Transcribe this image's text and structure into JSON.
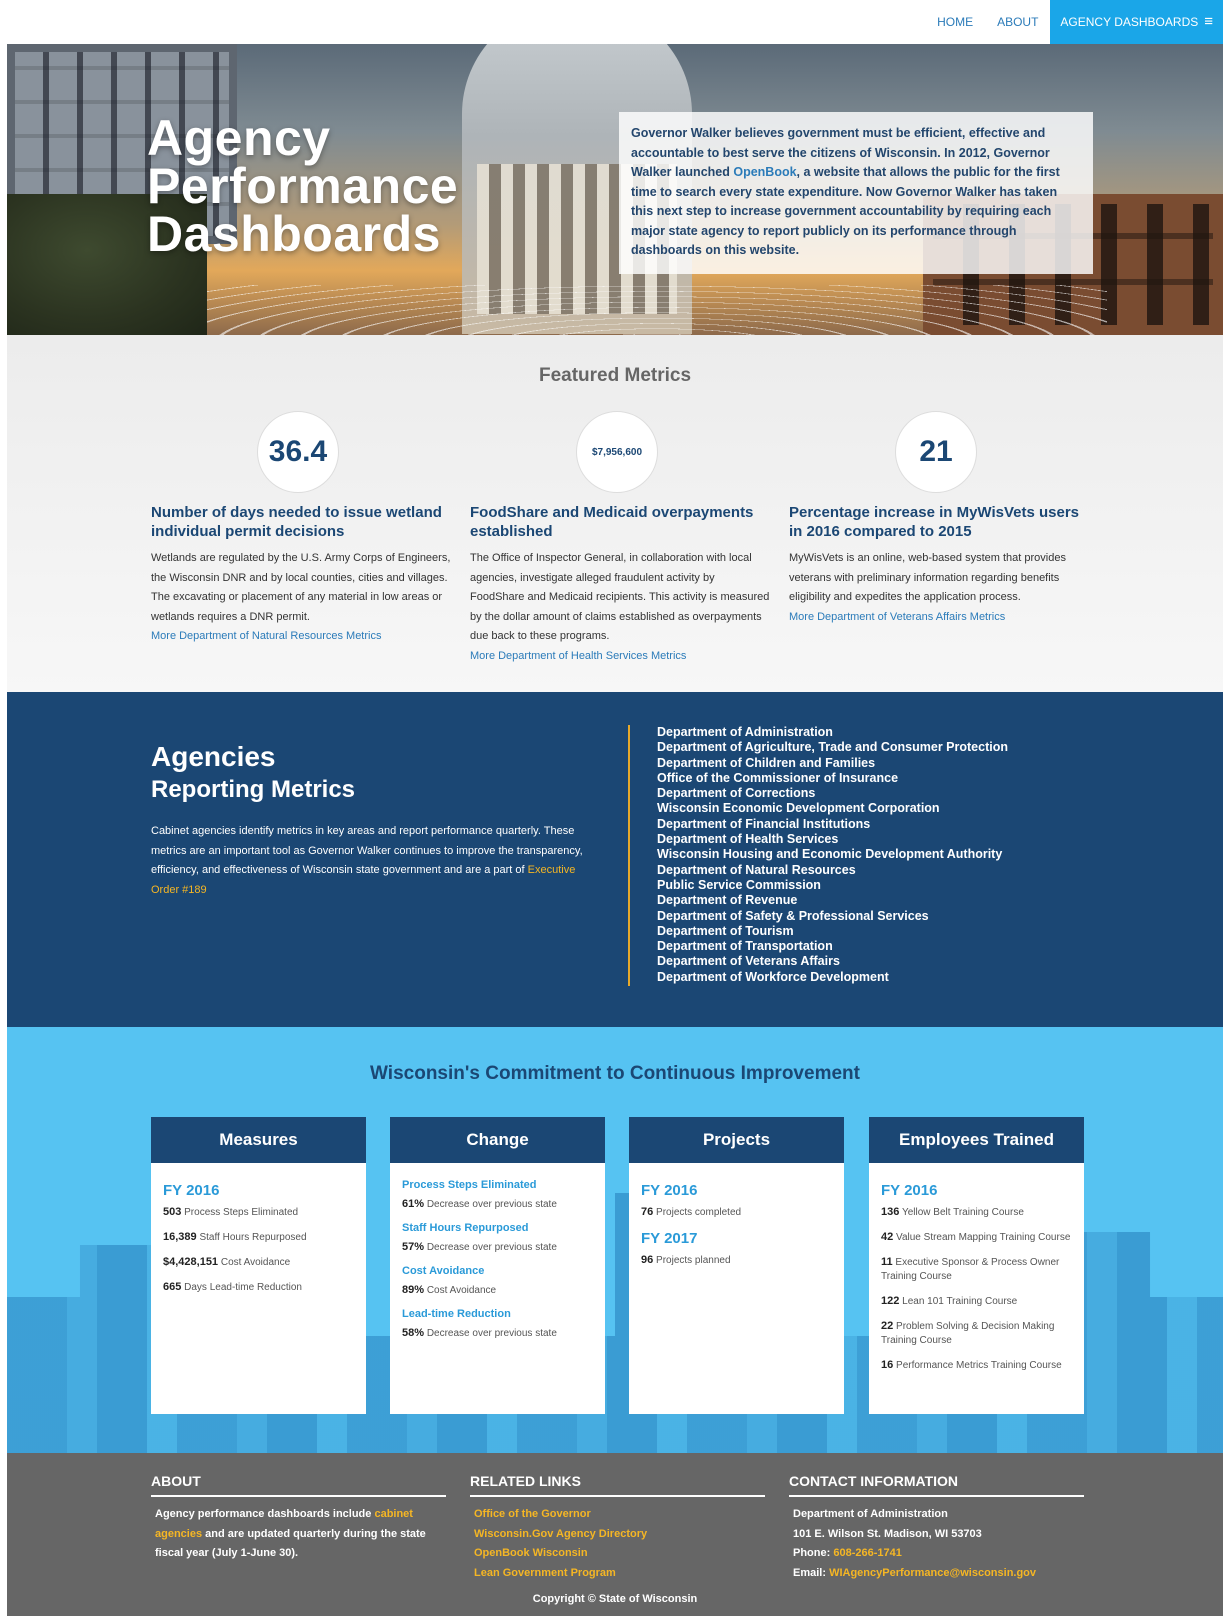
{
  "nav": {
    "home": "HOME",
    "about": "ABOUT",
    "dashboards": "AGENCY DASHBOARDS",
    "menu_glyph": "≡"
  },
  "hero": {
    "title_line1": "Agency",
    "title_line2": "Performance",
    "title_line3": "Dashboards",
    "intro_before": "Governor Walker believes government must be efficient, effective and accountable to best serve the citizens of Wisconsin. In 2012, Governor Walker launched ",
    "intro_link": "OpenBook",
    "intro_after": ", a website that allows the public for the first time to search every state expenditure. Now Governor Walker has taken this next step to increase government accountability by requiring each major state agency to report publicly on its performance through dashboards on this website."
  },
  "featured": {
    "title": "Featured Metrics",
    "metrics": [
      {
        "value": "36.4",
        "heading": "Number of days needed to issue wetland individual permit decisions",
        "text": "Wetlands are regulated by the U.S. Army Corps of Engineers, the Wisconsin DNR and by local counties, cities and villages. The excavating or placement of any material in low areas or wetlands requires a DNR permit.",
        "link": "More Department of Natural Resources Metrics"
      },
      {
        "value": "$7,956,600",
        "heading": "FoodShare and Medicaid overpayments established",
        "text": "The Office of Inspector General, in collaboration with local agencies, investigate alleged fraudulent activity by FoodShare and Medicaid recipients. This activity is measured by the dollar amount of claims established as overpayments due back to these programs.",
        "link": "More Department of Health Services Metrics"
      },
      {
        "value": "21",
        "heading": "Percentage increase in MyWisVets users in 2016 compared to 2015",
        "text": "MyWisVets is an online, web-based system that provides veterans with preliminary information regarding benefits eligibility and expedites the application process.",
        "link": "More Department of Veterans Affairs Metrics"
      }
    ]
  },
  "agencies": {
    "title1": "Agencies",
    "title2": "Reporting Metrics",
    "desc_before": "Cabinet agencies identify metrics in key areas and report performance quarterly. These metrics are an important tool as Governor Walker continues to improve the transparency, efficiency, and effectiveness of Wisconsin state government and are a part of ",
    "desc_link": "Executive Order #189",
    "list": [
      "Department of Administration",
      "Department of Agriculture, Trade and Consumer Protection",
      "Department of Children and Families",
      "Office of the Commissioner of Insurance",
      "Department of Corrections",
      "Wisconsin Economic Development Corporation",
      "Department of Financial Institutions",
      "Department of Health Services",
      "Wisconsin Housing and Economic Development Authority",
      "Department of Natural Resources",
      "Public Service Commission",
      "Department of Revenue",
      "Department of Safety & Professional Services",
      "Department of Tourism",
      "Department of Transportation",
      "Department of Veterans Affairs",
      "Department of Workforce Development"
    ]
  },
  "improve": {
    "title": "Wisconsin's Commitment to Continuous Improvement",
    "measures": {
      "head": "Measures",
      "fy": "FY 2016",
      "rows": [
        {
          "num": "503",
          "label": "Process Steps Eliminated"
        },
        {
          "num": "16,389",
          "label": "Staff Hours Repurposed"
        },
        {
          "num": "$4,428,151",
          "label": "Cost Avoidance"
        },
        {
          "num": "665",
          "label": "Days Lead-time Reduction"
        }
      ]
    },
    "change": {
      "head": "Change",
      "groups": [
        {
          "sub": "Process Steps Eliminated",
          "num": "61%",
          "label": "Decrease over previous state"
        },
        {
          "sub": "Staff Hours Repurposed",
          "num": "57%",
          "label": "Decrease over previous state"
        },
        {
          "sub": "Cost Avoidance",
          "num": "89%",
          "label": "Cost Avoidance"
        },
        {
          "sub": "Lead-time Reduction",
          "num": "58%",
          "label": "Decrease over previous state"
        }
      ]
    },
    "projects": {
      "head": "Projects",
      "fy1": "FY 2016",
      "row1": {
        "num": "76",
        "label": "Projects completed"
      },
      "fy2": "FY 2017",
      "row2": {
        "num": "96",
        "label": "Projects planned"
      }
    },
    "trained": {
      "head": "Employees Trained",
      "fy": "FY 2016",
      "rows": [
        {
          "num": "136",
          "label": "Yellow Belt Training Course"
        },
        {
          "num": "42",
          "label": "Value Stream Mapping Training Course"
        },
        {
          "num": "11",
          "label": "Executive Sponsor & Process Owner Training Course"
        },
        {
          "num": "122",
          "label": "Lean 101 Training Course"
        },
        {
          "num": "22",
          "label": "Problem Solving & Decision Making Training Course"
        },
        {
          "num": "16",
          "label": "Performance Metrics Training Course"
        }
      ]
    }
  },
  "footer": {
    "about": {
      "head": "ABOUT",
      "before": "Agency performance dashboards include ",
      "link": "cabinet agencies",
      "after": " and are updated quarterly during the state fiscal year (July 1-June 30)."
    },
    "links": {
      "head": "RELATED LINKS",
      "items": [
        "Office of the Governor",
        "Wisconsin.Gov Agency Directory",
        "OpenBook Wisconsin",
        "Lean Government Program"
      ]
    },
    "contact": {
      "head": "CONTACT INFORMATION",
      "org": "Department of Administration",
      "address": "101 E. Wilson St. Madison, WI 53703",
      "phone_label": "Phone: ",
      "phone": "608-266-1741",
      "email_label": "Email: ",
      "email": "WIAgencyPerformance@wisconsin.gov"
    },
    "copyright": "Copyright © State of Wisconsin"
  }
}
